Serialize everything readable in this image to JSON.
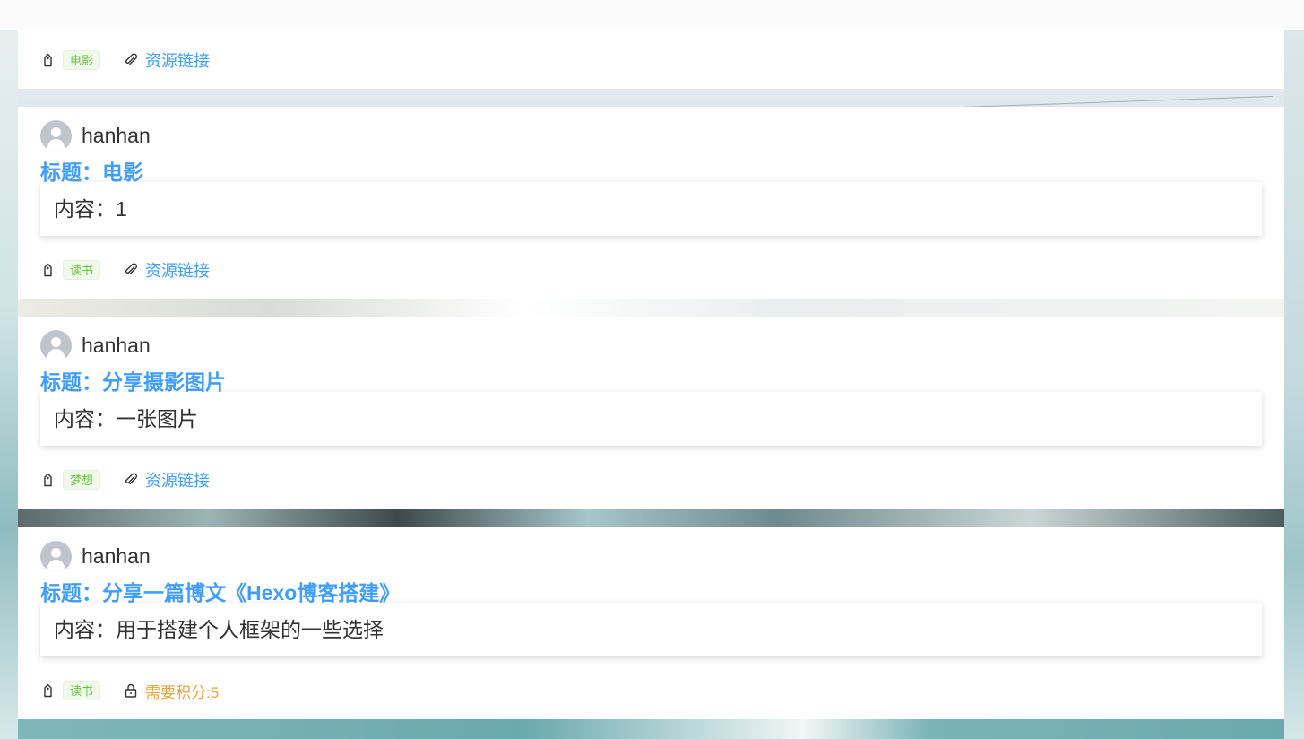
{
  "top_card": {
    "tag": "电影",
    "link_label": "资源链接"
  },
  "posts": [
    {
      "author": "hanhan",
      "title": "标题：电影",
      "content": "内容：1",
      "tag": "读书",
      "link_label": "资源链接"
    },
    {
      "author": "hanhan",
      "title": "标题：分享摄影图片",
      "content": "内容：一张图片",
      "tag": "梦想",
      "link_label": "资源链接"
    },
    {
      "author": "hanhan",
      "title": "标题：分享一篇博文《Hexo博客搭建》",
      "content": "内容：用于搭建个人框架的一些选择",
      "tag": "读书",
      "points_label": "需要积分:5"
    }
  ],
  "icons": {
    "tag": "price-tag-icon",
    "link": "paperclip-icon",
    "lock": "lock-icon",
    "avatar": "user-avatar-icon"
  },
  "colors": {
    "title": "#409eff",
    "link": "#409eff",
    "tag_text": "#67c23a",
    "tag_bg": "#f0f9eb",
    "points": "#e6a23c",
    "avatar_bg": "#c0c4cc"
  }
}
